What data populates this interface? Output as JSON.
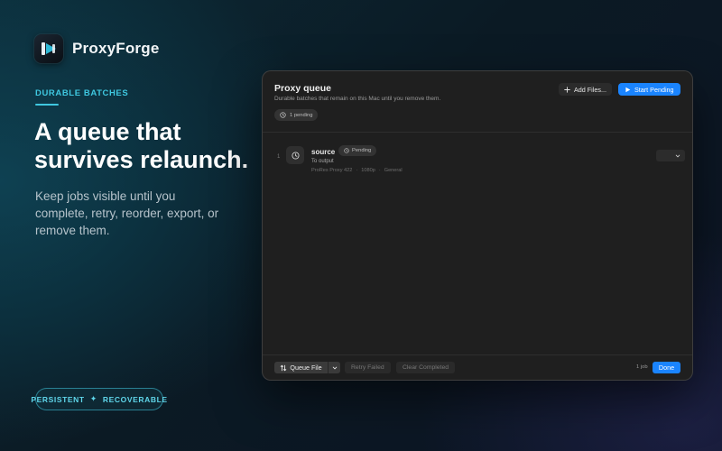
{
  "brand": {
    "name": "ProxyForge",
    "logo_icon": "play-frame-icon"
  },
  "hero": {
    "eyebrow": "DURABLE BATCHES",
    "headline_line1": "A queue that",
    "headline_line2": "survives relaunch.",
    "body": "Keep jobs visible until you complete, retry, reorder, export, or remove them."
  },
  "pill": {
    "left": "PERSISTENT",
    "separator": "✦",
    "right": "RECOVERABLE"
  },
  "window": {
    "title": "Proxy queue",
    "subtitle": "Durable batches that remain on this Mac until you remove them.",
    "pending_badge": "1 pending",
    "add_files_label": "Add Files...",
    "start_pending_label": "Start Pending",
    "jobs": [
      {
        "index": "1",
        "name": "source",
        "status": "Pending",
        "destination": "To output",
        "codec": "ProRes Proxy 422",
        "resolution": "1080p",
        "preset": "General",
        "meta_sep": "·"
      }
    ],
    "footer": {
      "queue_file_label": "Queue File",
      "retry_failed_label": "Retry Failed",
      "clear_completed_label": "Clear Completed",
      "job_count": "1 job",
      "done_label": "Done"
    }
  },
  "colors": {
    "accent": "#3fc8e0",
    "primary_button": "#1a84ff",
    "window_bg": "#1f1f1f"
  }
}
